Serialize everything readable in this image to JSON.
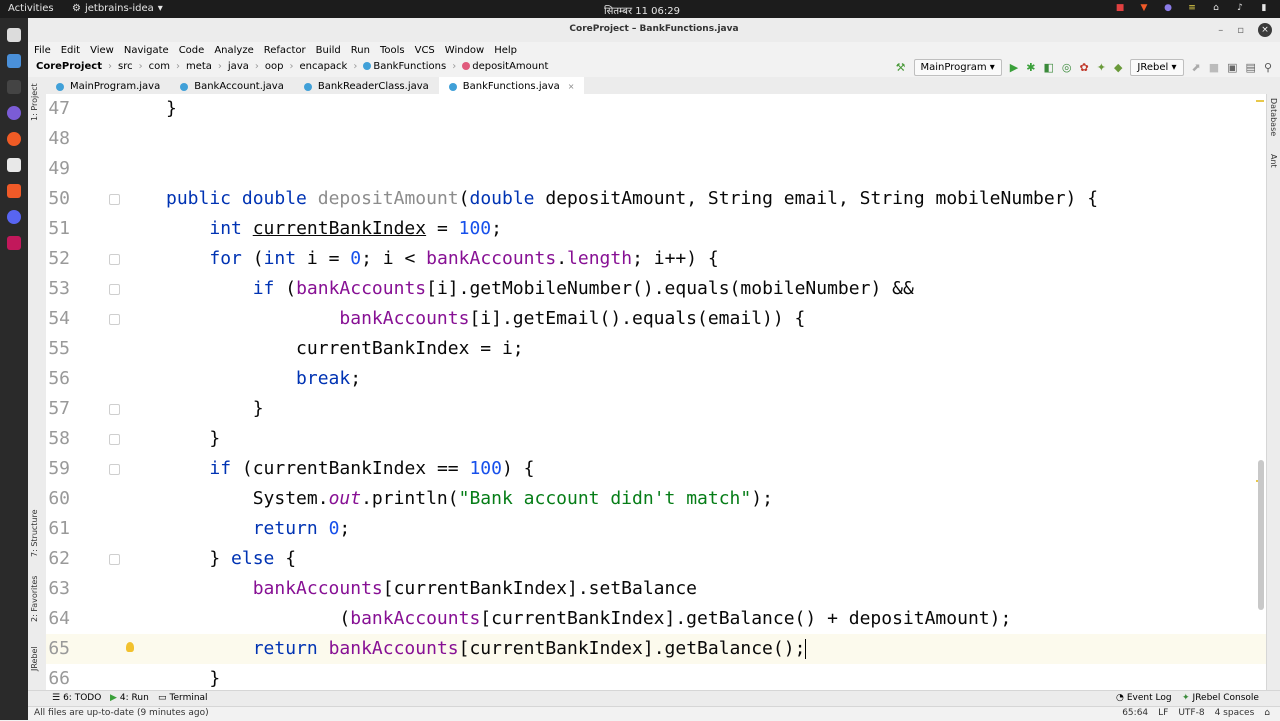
{
  "os": {
    "activities": "Activities",
    "app_name": "jetbrains-idea",
    "clock": "सितम्बर 11  06:29"
  },
  "window": {
    "title": "CoreProject – BankFunctions.java"
  },
  "menu": [
    "File",
    "Edit",
    "View",
    "Navigate",
    "Code",
    "Analyze",
    "Refactor",
    "Build",
    "Run",
    "Tools",
    "VCS",
    "Window",
    "Help"
  ],
  "breadcrumbs": {
    "project": "CoreProject",
    "parts": [
      "src",
      "com",
      "meta",
      "java",
      "oop",
      "encapack"
    ],
    "class": "BankFunctions",
    "method": "depositAmount"
  },
  "toolbar": {
    "run_config": "MainProgram",
    "jrebel": "JRebel"
  },
  "tabs": [
    {
      "label": "MainProgram.java",
      "active": false
    },
    {
      "label": "BankAccount.java",
      "active": false
    },
    {
      "label": "BankReaderClass.java",
      "active": false
    },
    {
      "label": "BankFunctions.java",
      "active": true
    }
  ],
  "side_tools": {
    "project": "1: Project",
    "structure": "7: Structure",
    "favorites": "2: Favorites",
    "jrebel": "JRebel",
    "database": "Database",
    "ant": "Ant"
  },
  "code_lines": [
    {
      "n": "47"
    },
    {
      "n": "48"
    },
    {
      "n": "49"
    },
    {
      "n": "50"
    },
    {
      "n": "51"
    },
    {
      "n": "52"
    },
    {
      "n": "53"
    },
    {
      "n": "54"
    },
    {
      "n": "55"
    },
    {
      "n": "56"
    },
    {
      "n": "57"
    },
    {
      "n": "58"
    },
    {
      "n": "59"
    },
    {
      "n": "60"
    },
    {
      "n": "61"
    },
    {
      "n": "62"
    },
    {
      "n": "63"
    },
    {
      "n": "64"
    },
    {
      "n": "65"
    },
    {
      "n": "66"
    }
  ],
  "code": {
    "l47_brace": "}",
    "l50": {
      "pub": "public",
      "dbl": "double",
      "name": "depositAmount",
      "p1t": "double",
      "p1": "depositAmount,",
      "p2": "String email, String mobileNumber) {"
    },
    "l51": {
      "kw": "int",
      "var": "currentBankIndex",
      "eq": " = ",
      "num": "100",
      ";": ";"
    },
    "l52": {
      "kw": "for",
      "a": "(",
      "int": "int",
      "b": " i = ",
      "zero": "0",
      "c": "; i < ",
      "arr": "bankAccounts",
      "d": ".",
      "len": "length",
      "e": "; i++) {"
    },
    "l53": {
      "kw": "if",
      "a": "(",
      "arr": "bankAccounts",
      "b": "[i].getMobileNumber().equals(mobileNumber) &&"
    },
    "l54": {
      "arr": "bankAccounts",
      "b": "[i].getEmail().equals(email)) {"
    },
    "l55": {
      "a": "currentBankIndex = i;"
    },
    "l56": {
      "kw": "break",
      "b": ";"
    },
    "l57": "}",
    "l58": "}",
    "l59": {
      "kw": "if",
      "a": " (currentBankIndex == ",
      "num": "100",
      "b": ") {"
    },
    "l60": {
      "a": "System.",
      "out": "out",
      "b": ".println(",
      "str": "\"Bank account didn't match\"",
      "c": ");"
    },
    "l61": {
      "kw": "return",
      "num": "0",
      "b": ";"
    },
    "l62": {
      "a": "} ",
      "kw": "else",
      "b": " {"
    },
    "l63": {
      "arr": "bankAccounts",
      "b": "[currentBankIndex].setBalance"
    },
    "l64": {
      "a": "(",
      "arr": "bankAccounts",
      "b": "[currentBankIndex].getBalance() + depositAmount);"
    },
    "l65": {
      "kw": "return",
      "arr": "bankAccounts",
      "b": "[currentBankIndex].getBalance();"
    },
    "l66": "}"
  },
  "bottom_tools": {
    "todo": "6: TODO",
    "run": "4: Run",
    "terminal": "Terminal",
    "event_log": "Event Log",
    "jrebel_console": "JRebel Console"
  },
  "status": {
    "message": "All files are up-to-date (9 minutes ago)",
    "position": "65:64",
    "line_sep": "LF",
    "encoding": "UTF-8",
    "indent": "4 spaces"
  }
}
